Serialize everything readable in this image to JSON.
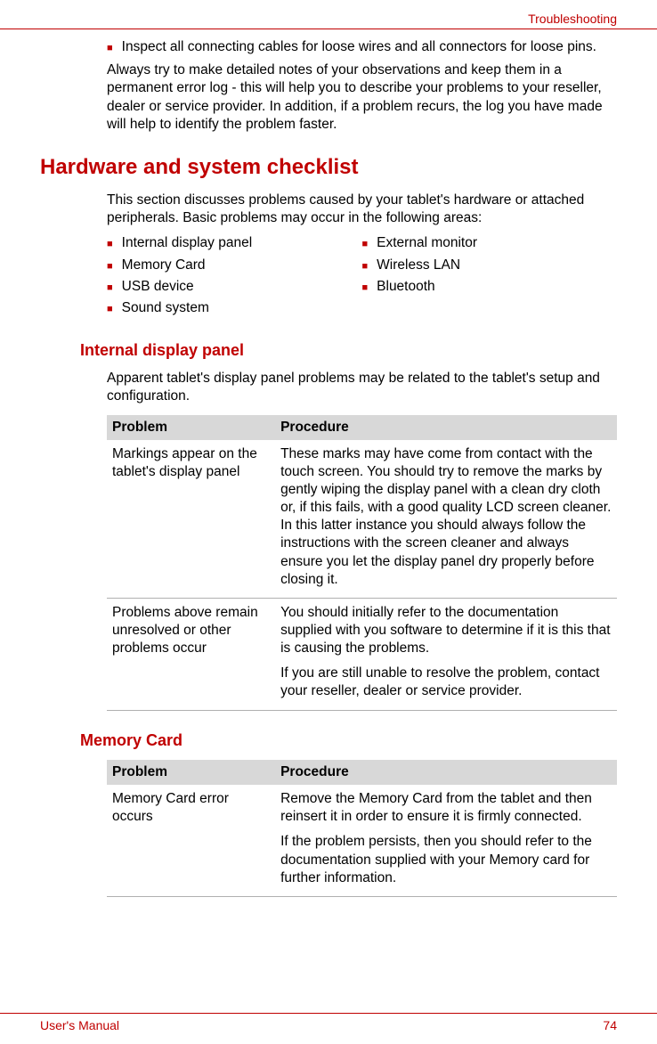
{
  "header": {
    "section": "Troubleshooting"
  },
  "top_bullet": "Inspect all connecting cables for loose wires and all connectors for loose pins.",
  "top_para": "Always try to make detailed notes of your observations and keep them in a permanent error log - this will help you to describe your problems to your reseller, dealer or service provider. In addition, if a problem recurs, the log you have made will help to identify the problem faster.",
  "h1": "Hardware and system checklist",
  "h1_para": "This section discusses problems caused by your tablet's hardware or attached peripherals. Basic problems may occur in the following areas:",
  "checklist_left": [
    "Internal display panel",
    "Memory Card",
    "USB device",
    "Sound system"
  ],
  "checklist_right": [
    "External monitor",
    "Wireless LAN",
    "Bluetooth"
  ],
  "section1": {
    "title": "Internal display panel",
    "para": "Apparent tablet's display panel problems may be related to the tablet's setup and configuration.",
    "th_problem": "Problem",
    "th_procedure": "Procedure",
    "rows": [
      {
        "problem": "Markings appear on the tablet's display panel",
        "procedure": [
          "These marks may have come from contact with the touch screen. You should try to remove the marks by gently wiping the display panel with a clean dry cloth or, if this fails, with a good quality LCD screen cleaner. In this latter instance you should always follow the instructions with the screen cleaner and always ensure you let the display panel dry properly before closing it."
        ]
      },
      {
        "problem": "Problems above remain unresolved or other problems occur",
        "procedure": [
          "You should initially refer to the documentation supplied with you software to determine if it is this that is causing the problems.",
          "If you are still unable to resolve the problem, contact your reseller, dealer or service provider."
        ]
      }
    ]
  },
  "section2": {
    "title": "Memory Card",
    "th_problem": "Problem",
    "th_procedure": "Procedure",
    "rows": [
      {
        "problem": "Memory Card error occurs",
        "procedure": [
          "Remove the Memory Card from the tablet and then reinsert it in order to ensure it is firmly connected.",
          "If the problem persists, then you should refer to the documentation supplied with your Memory card for further information."
        ]
      }
    ]
  },
  "footer": {
    "left": "User's Manual",
    "right": "74"
  }
}
